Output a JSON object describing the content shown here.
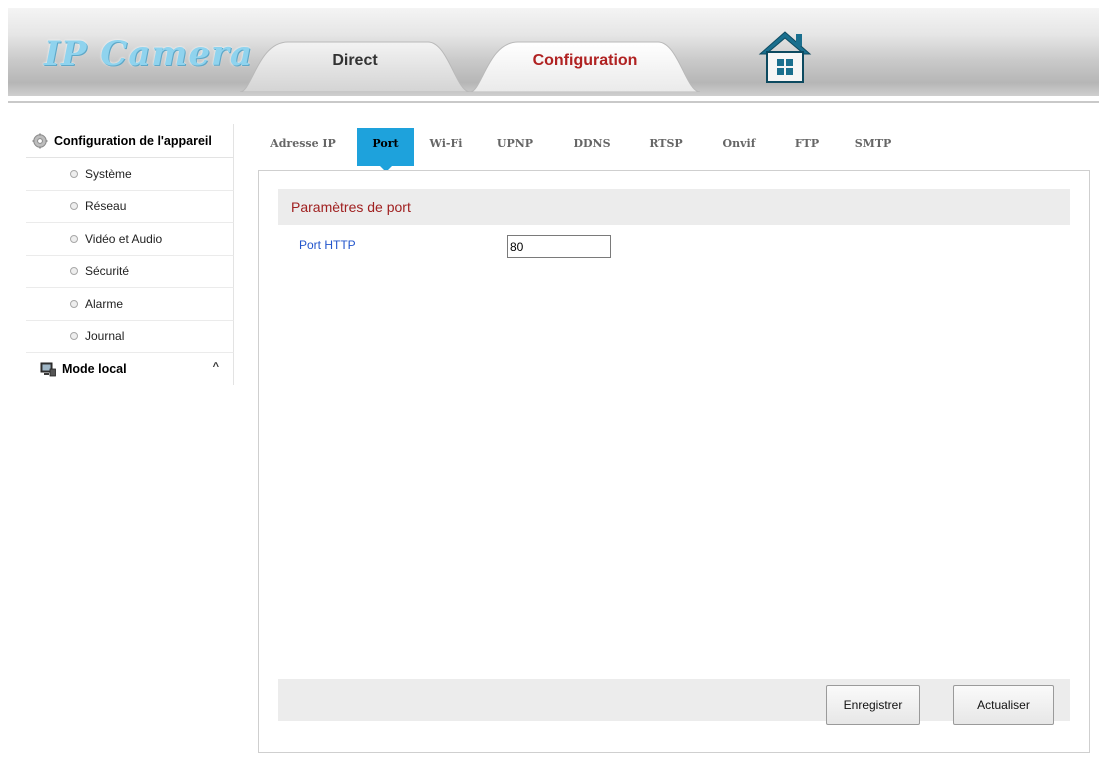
{
  "header": {
    "logo_text": "IP Camera",
    "tabs": [
      {
        "label": "Direct",
        "active": false
      },
      {
        "label": "Configuration",
        "active": true
      }
    ],
    "home_icon": "home-icon"
  },
  "sidebar": {
    "section_title": "Configuration de l'appareil",
    "section_icon": "gear-icon",
    "items": [
      {
        "label": "Système"
      },
      {
        "label": "Réseau"
      },
      {
        "label": "Vidéo et Audio"
      },
      {
        "label": "Sécurité"
      },
      {
        "label": "Alarme"
      },
      {
        "label": "Journal"
      }
    ],
    "local_mode": {
      "label": "Mode local",
      "icon": "computer-icon",
      "caret": "^"
    }
  },
  "subtabs": [
    {
      "label": "Adresse IP",
      "active": false
    },
    {
      "label": "Port",
      "active": true
    },
    {
      "label": "Wi-Fi",
      "active": false
    },
    {
      "label": "UPNP",
      "active": false
    },
    {
      "label": "DDNS",
      "active": false
    },
    {
      "label": "RTSP",
      "active": false
    },
    {
      "label": "Onvif",
      "active": false
    },
    {
      "label": "FTP",
      "active": false
    },
    {
      "label": "SMTP",
      "active": false
    }
  ],
  "panel": {
    "section_title": "Paramètres de port",
    "fields": [
      {
        "label": "Port HTTP",
        "value": "80"
      }
    ],
    "buttons": {
      "save": "Enregistrer",
      "refresh": "Actualiser"
    }
  },
  "colors": {
    "accent_blue": "#1ea2dc",
    "title_red": "#a02020",
    "label_blue": "#2255cc"
  }
}
